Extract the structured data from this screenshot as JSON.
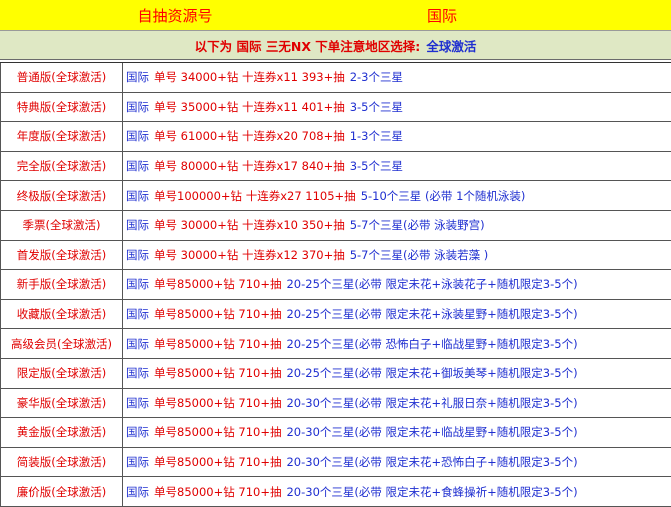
{
  "header": {
    "left_label": "自抽资源号",
    "right_label": "国际",
    "background": "#ffff00"
  },
  "subheader": {
    "red_part": "以下为 国际 三无NX 下单注意地区选择:",
    "blue_part": "全球激活"
  },
  "colors": {
    "red": "#e00000",
    "blue": "#1f2fd0",
    "subheader_bg": "#dfe8c4"
  },
  "rows": [
    {
      "name": "普通版(全球激活)",
      "region": "国际",
      "spec": "单号  34000+钻 十连券x11  393+抽",
      "extra": "2-3个三星"
    },
    {
      "name": "特典版(全球激活)",
      "region": "国际",
      "spec": "单号  35000+钻 十连券x11  401+抽",
      "extra": "3-5个三星"
    },
    {
      "name": "年度版(全球激活)",
      "region": "国际",
      "spec": "单号  61000+钻 十连券x20  708+抽",
      "extra": "1-3个三星"
    },
    {
      "name": "完全版(全球激活)",
      "region": "国际",
      "spec": "单号  80000+钻 十连券x17  840+抽",
      "extra": "3-5个三星"
    },
    {
      "name": "终极版(全球激活)",
      "region": "国际",
      "spec": "单号100000+钻 十连券x27  1105+抽",
      "extra": "5-10个三星 (必带 1个随机泳装)"
    },
    {
      "name": "季票(全球激活)",
      "region": "国际",
      "spec": "单号  30000+钻 十连券x10  350+抽",
      "extra": "5-7个三星(必带 泳装野宫)"
    },
    {
      "name": "首发版(全球激活)",
      "region": "国际",
      "spec": "单号  30000+钻 十连券x12  370+抽",
      "extra": "5-7个三星(必带 泳装若藻 )"
    },
    {
      "name": "新手版(全球激活)",
      "region": "国际",
      "spec": "单号85000+钻 710+抽",
      "extra": "20-25个三星(必带 限定未花+泳装花子+随机限定3-5个)"
    },
    {
      "name": "收藏版(全球激活)",
      "region": "国际",
      "spec": "单号85000+钻 710+抽",
      "extra": "20-25个三星(必带 限定未花+泳装星野+随机限定3-5个)"
    },
    {
      "name": "高级会员(全球激活)",
      "region": "国际",
      "spec": "单号85000+钻 710+抽",
      "extra": "20-25个三星(必带 恐怖白子+临战星野+随机限定3-5个)"
    },
    {
      "name": "限定版(全球激活)",
      "region": "国际",
      "spec": "单号85000+钻 710+抽",
      "extra": "20-25个三星(必带 限定未花+御坂美琴+随机限定3-5个)"
    },
    {
      "name": "豪华版(全球激活)",
      "region": "国际",
      "spec": "单号85000+钻 710+抽",
      "extra": "20-30个三星(必带 限定未花+礼服日奈+随机限定3-5个)"
    },
    {
      "name": "黄金版(全球激活)",
      "region": "国际",
      "spec": "单号85000+钻 710+抽",
      "extra": "20-30个三星(必带 限定未花+临战星野+随机限定3-5个)"
    },
    {
      "name": "简装版(全球激活)",
      "region": "国际",
      "spec": "单号85000+钻 710+抽",
      "extra": "20-30个三星(必带 限定未花+恐怖白子+随机限定3-5个)"
    },
    {
      "name": "廉价版(全球激活)",
      "region": "国际",
      "spec": "单号85000+钻 710+抽",
      "extra": "20-30个三星(必带 限定未花+食蜂操祈+随机限定3-5个)"
    }
  ]
}
